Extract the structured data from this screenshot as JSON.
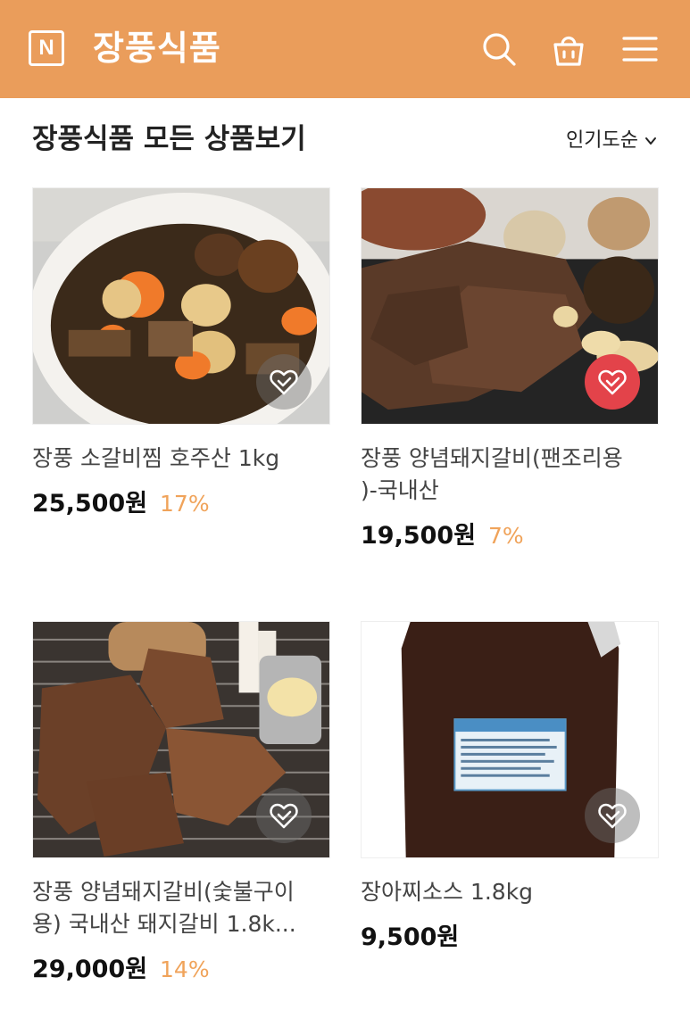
{
  "header": {
    "logo_letter": "N",
    "brand_name": "장풍식품",
    "icons": [
      "search-icon",
      "shopping-bag-icon",
      "menu-icon"
    ],
    "bg_color": "#ea9d5b"
  },
  "section": {
    "title": "장풍식품 모든 상품보기",
    "sort_label": "인기도순"
  },
  "products": [
    {
      "name": "장풍 소갈비찜 호주산 1kg",
      "price": "25,500원",
      "discount": "17%",
      "wishlisted": false
    },
    {
      "name_line1": "장풍 양념돼지갈비(팬조리용",
      "name_line2": ")-국내산",
      "price": "19,500원",
      "discount": "7%",
      "wishlisted": true
    },
    {
      "name_line1": "장풍 양념돼지갈비(숯불구이",
      "name_line2": "용) 국내산 돼지갈비 1.8k...",
      "price": "29,000원",
      "discount": "14%",
      "wishlisted": false
    },
    {
      "name": "장아찌소스 1.8kg",
      "price": "9,500원",
      "discount": "",
      "wishlisted": false
    }
  ],
  "colors": {
    "accent": "#ea9d5b",
    "discount": "#f0a35a",
    "wish_active": "#e3434a"
  }
}
